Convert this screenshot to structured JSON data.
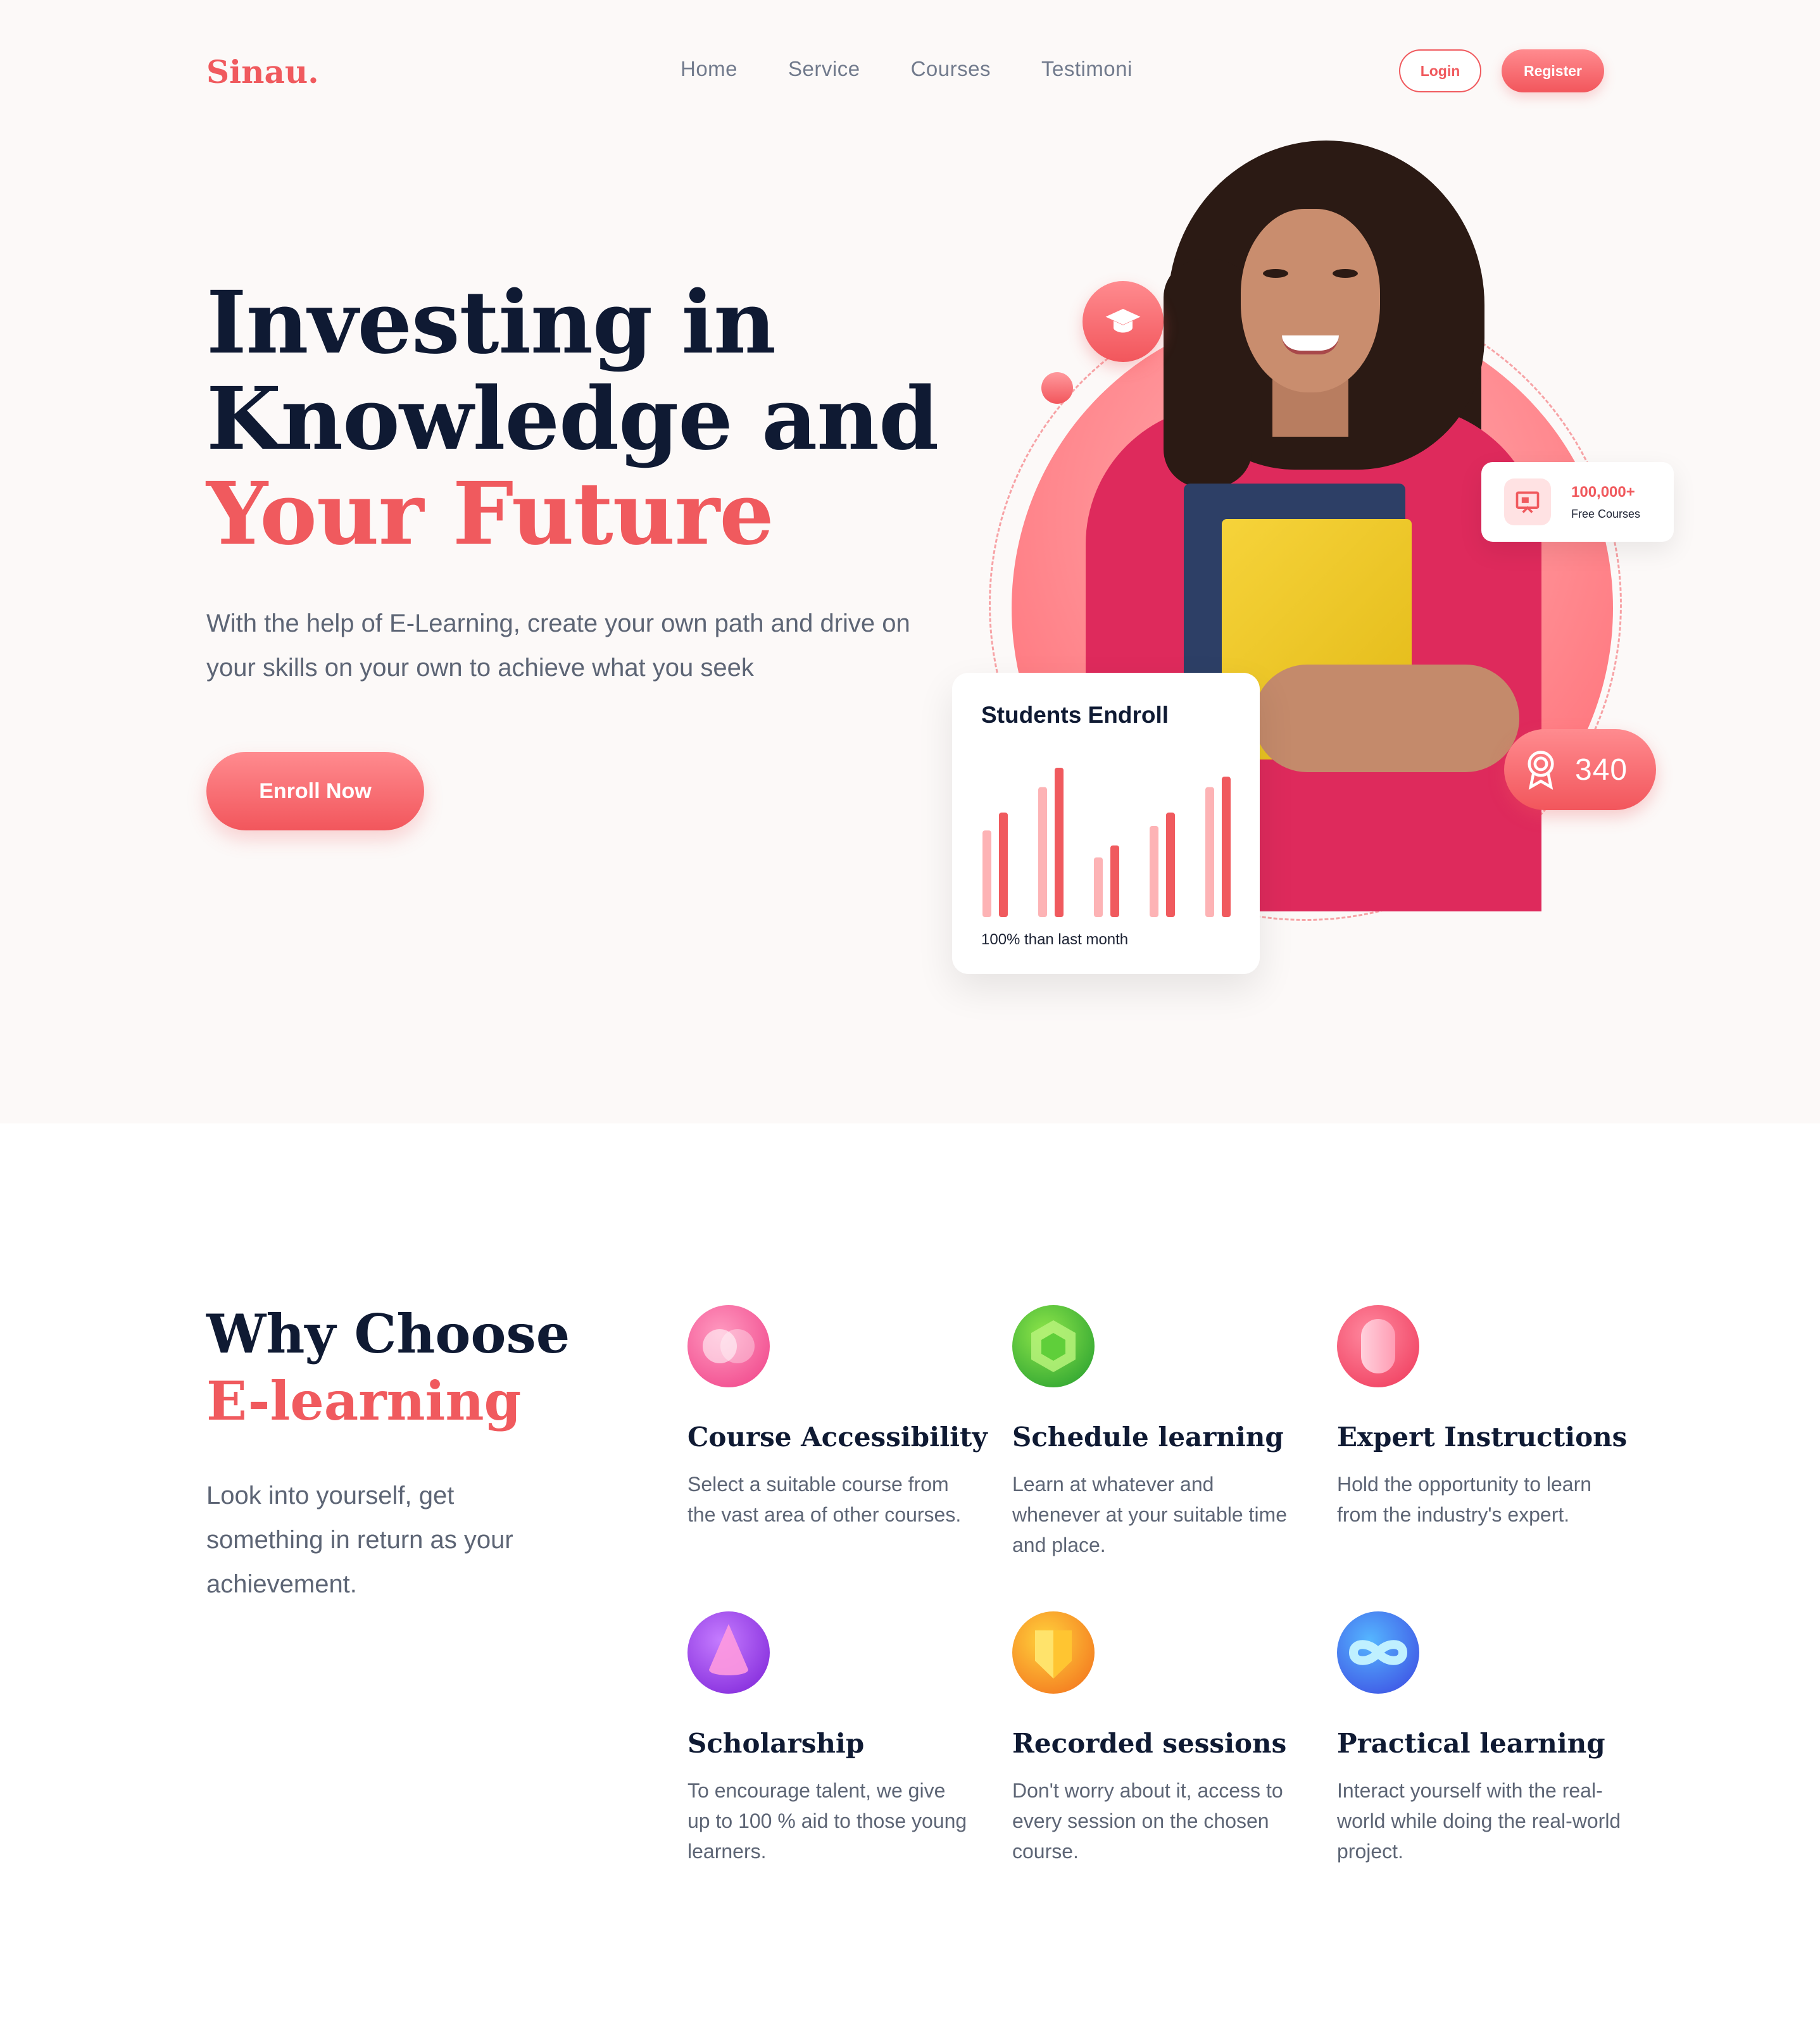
{
  "brand": {
    "logo": "Sinau.",
    "accent": "#f05a5e",
    "dark": "#0f1a33"
  },
  "nav": {
    "items": [
      "Home",
      "Service",
      "Courses",
      "Testimoni"
    ]
  },
  "auth": {
    "login": "Login",
    "register": "Register"
  },
  "hero": {
    "title_line1": "Investing in",
    "title_line2": "Knowledge and",
    "title_line3": "Your Future",
    "subtitle": "With the help of E-Learning, create your own path and drive on your skills on your own to achieve what you seek",
    "cta": "Enroll Now"
  },
  "stats": {
    "courses_value": "100,000+",
    "courses_label": "Free Courses",
    "badge_value": "340"
  },
  "students_card": {
    "title": "Students Endroll",
    "footer": "100% than last month",
    "bars": [
      {
        "light": 0.58,
        "dark": 0.7
      },
      {
        "light": 0.87,
        "dark": 1.0
      },
      {
        "light": 0.4,
        "dark": 0.48
      },
      {
        "light": 0.61,
        "dark": 0.7
      },
      {
        "light": 0.87,
        "dark": 0.94
      }
    ]
  },
  "why": {
    "title_line1": "Why Choose",
    "title_line2": "E-learning",
    "subtitle": "Look into yourself, get something in return as your achievement."
  },
  "features": [
    {
      "title": "Course Accessibility",
      "desc": "Select a suitable course from the vast area of other courses.",
      "icon": "circles-icon"
    },
    {
      "title": "Schedule learning",
      "desc": "Learn at whatever and whenever at your suitable time and place.",
      "icon": "gem-icon"
    },
    {
      "title": "Expert Instructions",
      "desc": "Hold the opportunity to learn from the industry's expert.",
      "icon": "cylinder-icon"
    },
    {
      "title": "Scholarship",
      "desc": "To encourage talent, we give up to 100 % aid to those young learners.",
      "icon": "cone-icon"
    },
    {
      "title": "Recorded sessions",
      "desc": "Don't worry about it, access to every session on the chosen course.",
      "icon": "shield-icon"
    },
    {
      "title": "Practical learning",
      "desc": "Interact yourself with the real-world while doing the real-world project.",
      "icon": "infinity-icon"
    }
  ]
}
